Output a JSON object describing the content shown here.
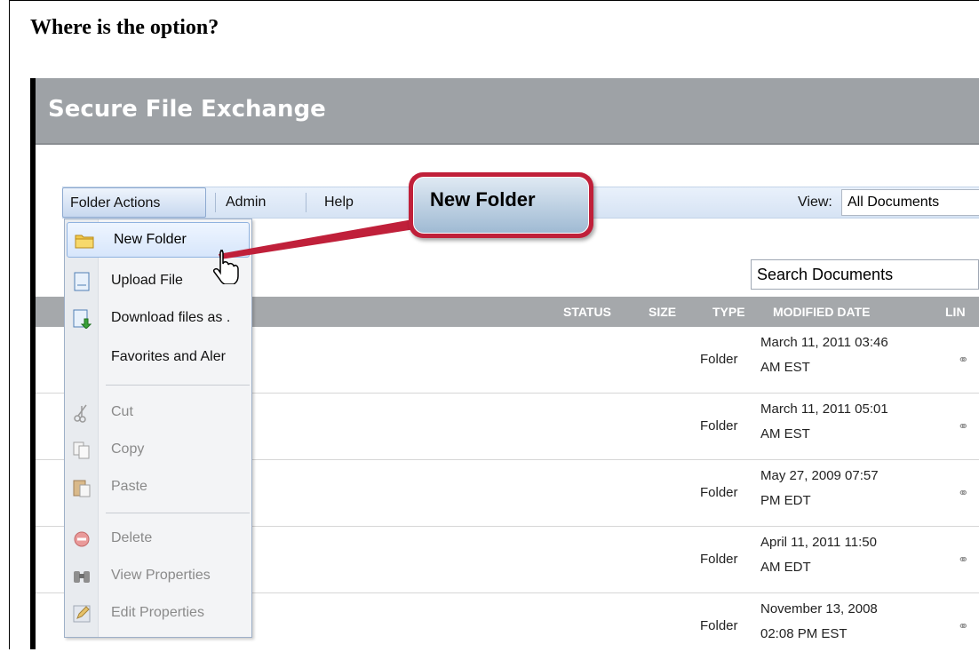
{
  "question": "Where is the option?",
  "app": {
    "title": "Secure File Exchange",
    "toolbar": {
      "folder_actions": "Folder Actions",
      "admin": "Admin",
      "help": "Help",
      "view_label": "View:",
      "view_value": "All Documents"
    },
    "search": {
      "placeholder": "Search Documents"
    },
    "grid": {
      "headers": {
        "status": "STATUS",
        "size": "SIZE",
        "type": "TYPE",
        "modified": "MODIFIED DATE",
        "link": "LIN"
      },
      "rows": [
        {
          "type": "Folder",
          "date_line1": "March 11, 2011 03:46",
          "date_line2": "AM EST"
        },
        {
          "type": "Folder",
          "date_line1": "March 11, 2011 05:01",
          "date_line2": "AM EST"
        },
        {
          "type": "Folder",
          "date_line1": "May 27, 2009 07:57",
          "date_line2": "PM EDT"
        },
        {
          "type": "Folder",
          "date_line1": "April 11, 2011 11:50",
          "date_line2": "AM EDT"
        },
        {
          "type": "Folder",
          "date_line1": "November 13, 2008",
          "date_line2": "02:08 PM EST"
        }
      ]
    },
    "menu": {
      "items": [
        {
          "label": "New Folder",
          "icon": "folder-icon",
          "state": "hover"
        },
        {
          "label": "Upload File",
          "icon": "document-icon",
          "state": "enabled"
        },
        {
          "label": "Download files as .",
          "icon": "download-icon",
          "state": "enabled"
        },
        {
          "label": "Favorites and Aler",
          "icon": "favorites-icon",
          "state": "enabled"
        },
        {
          "label": "Cut",
          "icon": "scissors-icon",
          "state": "disabled"
        },
        {
          "label": "Copy",
          "icon": "copy-icon",
          "state": "disabled"
        },
        {
          "label": "Paste",
          "icon": "paste-icon",
          "state": "disabled"
        },
        {
          "label": "Delete",
          "icon": "delete-icon",
          "state": "disabled"
        },
        {
          "label": "View Properties",
          "icon": "binoculars-icon",
          "state": "disabled"
        },
        {
          "label": "Edit Properties",
          "icon": "pencil-icon",
          "state": "disabled"
        }
      ]
    }
  },
  "callout": {
    "text": "New Folder",
    "color": "#c0203a"
  }
}
